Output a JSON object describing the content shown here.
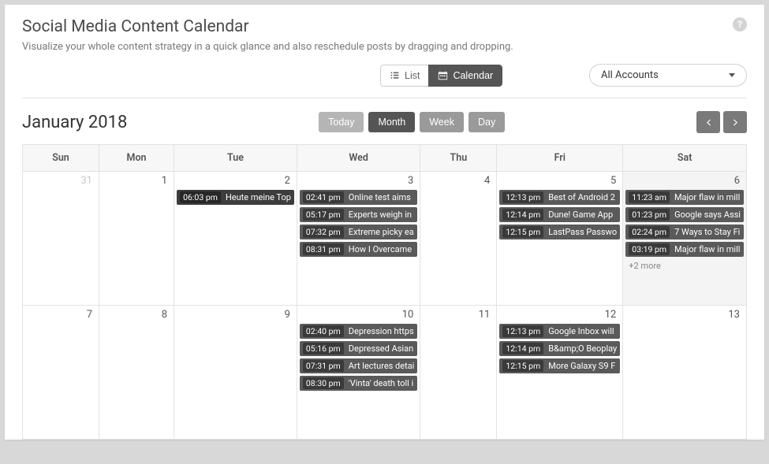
{
  "header": {
    "title": "Social Media Content Calendar",
    "subtitle": "Visualize your whole content strategy in a quick glance and also reschedule posts by dragging and dropping."
  },
  "viewToggle": {
    "list": "List",
    "calendar": "Calendar"
  },
  "accountDropdown": {
    "selected": "All Accounts"
  },
  "monthLabel": "January 2018",
  "rangeButtons": {
    "today": "Today",
    "month": "Month",
    "week": "Week",
    "day": "Day"
  },
  "dayHeaders": [
    "Sun",
    "Mon",
    "Tue",
    "Wed",
    "Thu",
    "Fri",
    "Sat"
  ],
  "weeks": [
    [
      {
        "num": "31",
        "muted": true,
        "events": []
      },
      {
        "num": "1",
        "events": []
      },
      {
        "num": "2",
        "events": [
          {
            "time": "06:03 pm",
            "title": "Heute meine Top",
            "dark": true
          }
        ]
      },
      {
        "num": "3",
        "events": [
          {
            "time": "02:41 pm",
            "title": "Online test aims"
          },
          {
            "time": "05:17 pm",
            "title": "Experts weigh in"
          },
          {
            "time": "07:32 pm",
            "title": "Extreme picky ea"
          },
          {
            "time": "08:31 pm",
            "title": "How I Overcame"
          }
        ]
      },
      {
        "num": "4",
        "events": []
      },
      {
        "num": "5",
        "events": [
          {
            "time": "12:13 pm",
            "title": "Best of Android 2"
          },
          {
            "time": "12:14 pm",
            "title": "Dune! Game App"
          },
          {
            "time": "12:15 pm",
            "title": "LastPass Passwo"
          }
        ]
      },
      {
        "num": "6",
        "highlight": true,
        "events": [
          {
            "time": "11:23 am",
            "title": "Major flaw in mill"
          },
          {
            "time": "01:23 pm",
            "title": "Google says Assi"
          },
          {
            "time": "02:24 pm",
            "title": "7 Ways to Stay Fi"
          },
          {
            "time": "03:19 pm",
            "title": "Major flaw in mill"
          }
        ],
        "more": "+2 more"
      }
    ],
    [
      {
        "num": "7",
        "events": []
      },
      {
        "num": "8",
        "events": []
      },
      {
        "num": "9",
        "events": []
      },
      {
        "num": "10",
        "events": [
          {
            "time": "02:40 pm",
            "title": "Depression https"
          },
          {
            "time": "05:16 pm",
            "title": "Depressed Asian"
          },
          {
            "time": "07:31 pm",
            "title": "Art lectures detai"
          },
          {
            "time": "08:30 pm",
            "title": "'Vinta' death toll i"
          }
        ]
      },
      {
        "num": "11",
        "events": []
      },
      {
        "num": "12",
        "events": [
          {
            "time": "12:13 pm",
            "title": "Google Inbox will"
          },
          {
            "time": "12:14 pm",
            "title": "B&amp;O Beoplay"
          },
          {
            "time": "12:15 pm",
            "title": "More Galaxy S9 F"
          }
        ]
      },
      {
        "num": "13",
        "events": []
      }
    ]
  ]
}
